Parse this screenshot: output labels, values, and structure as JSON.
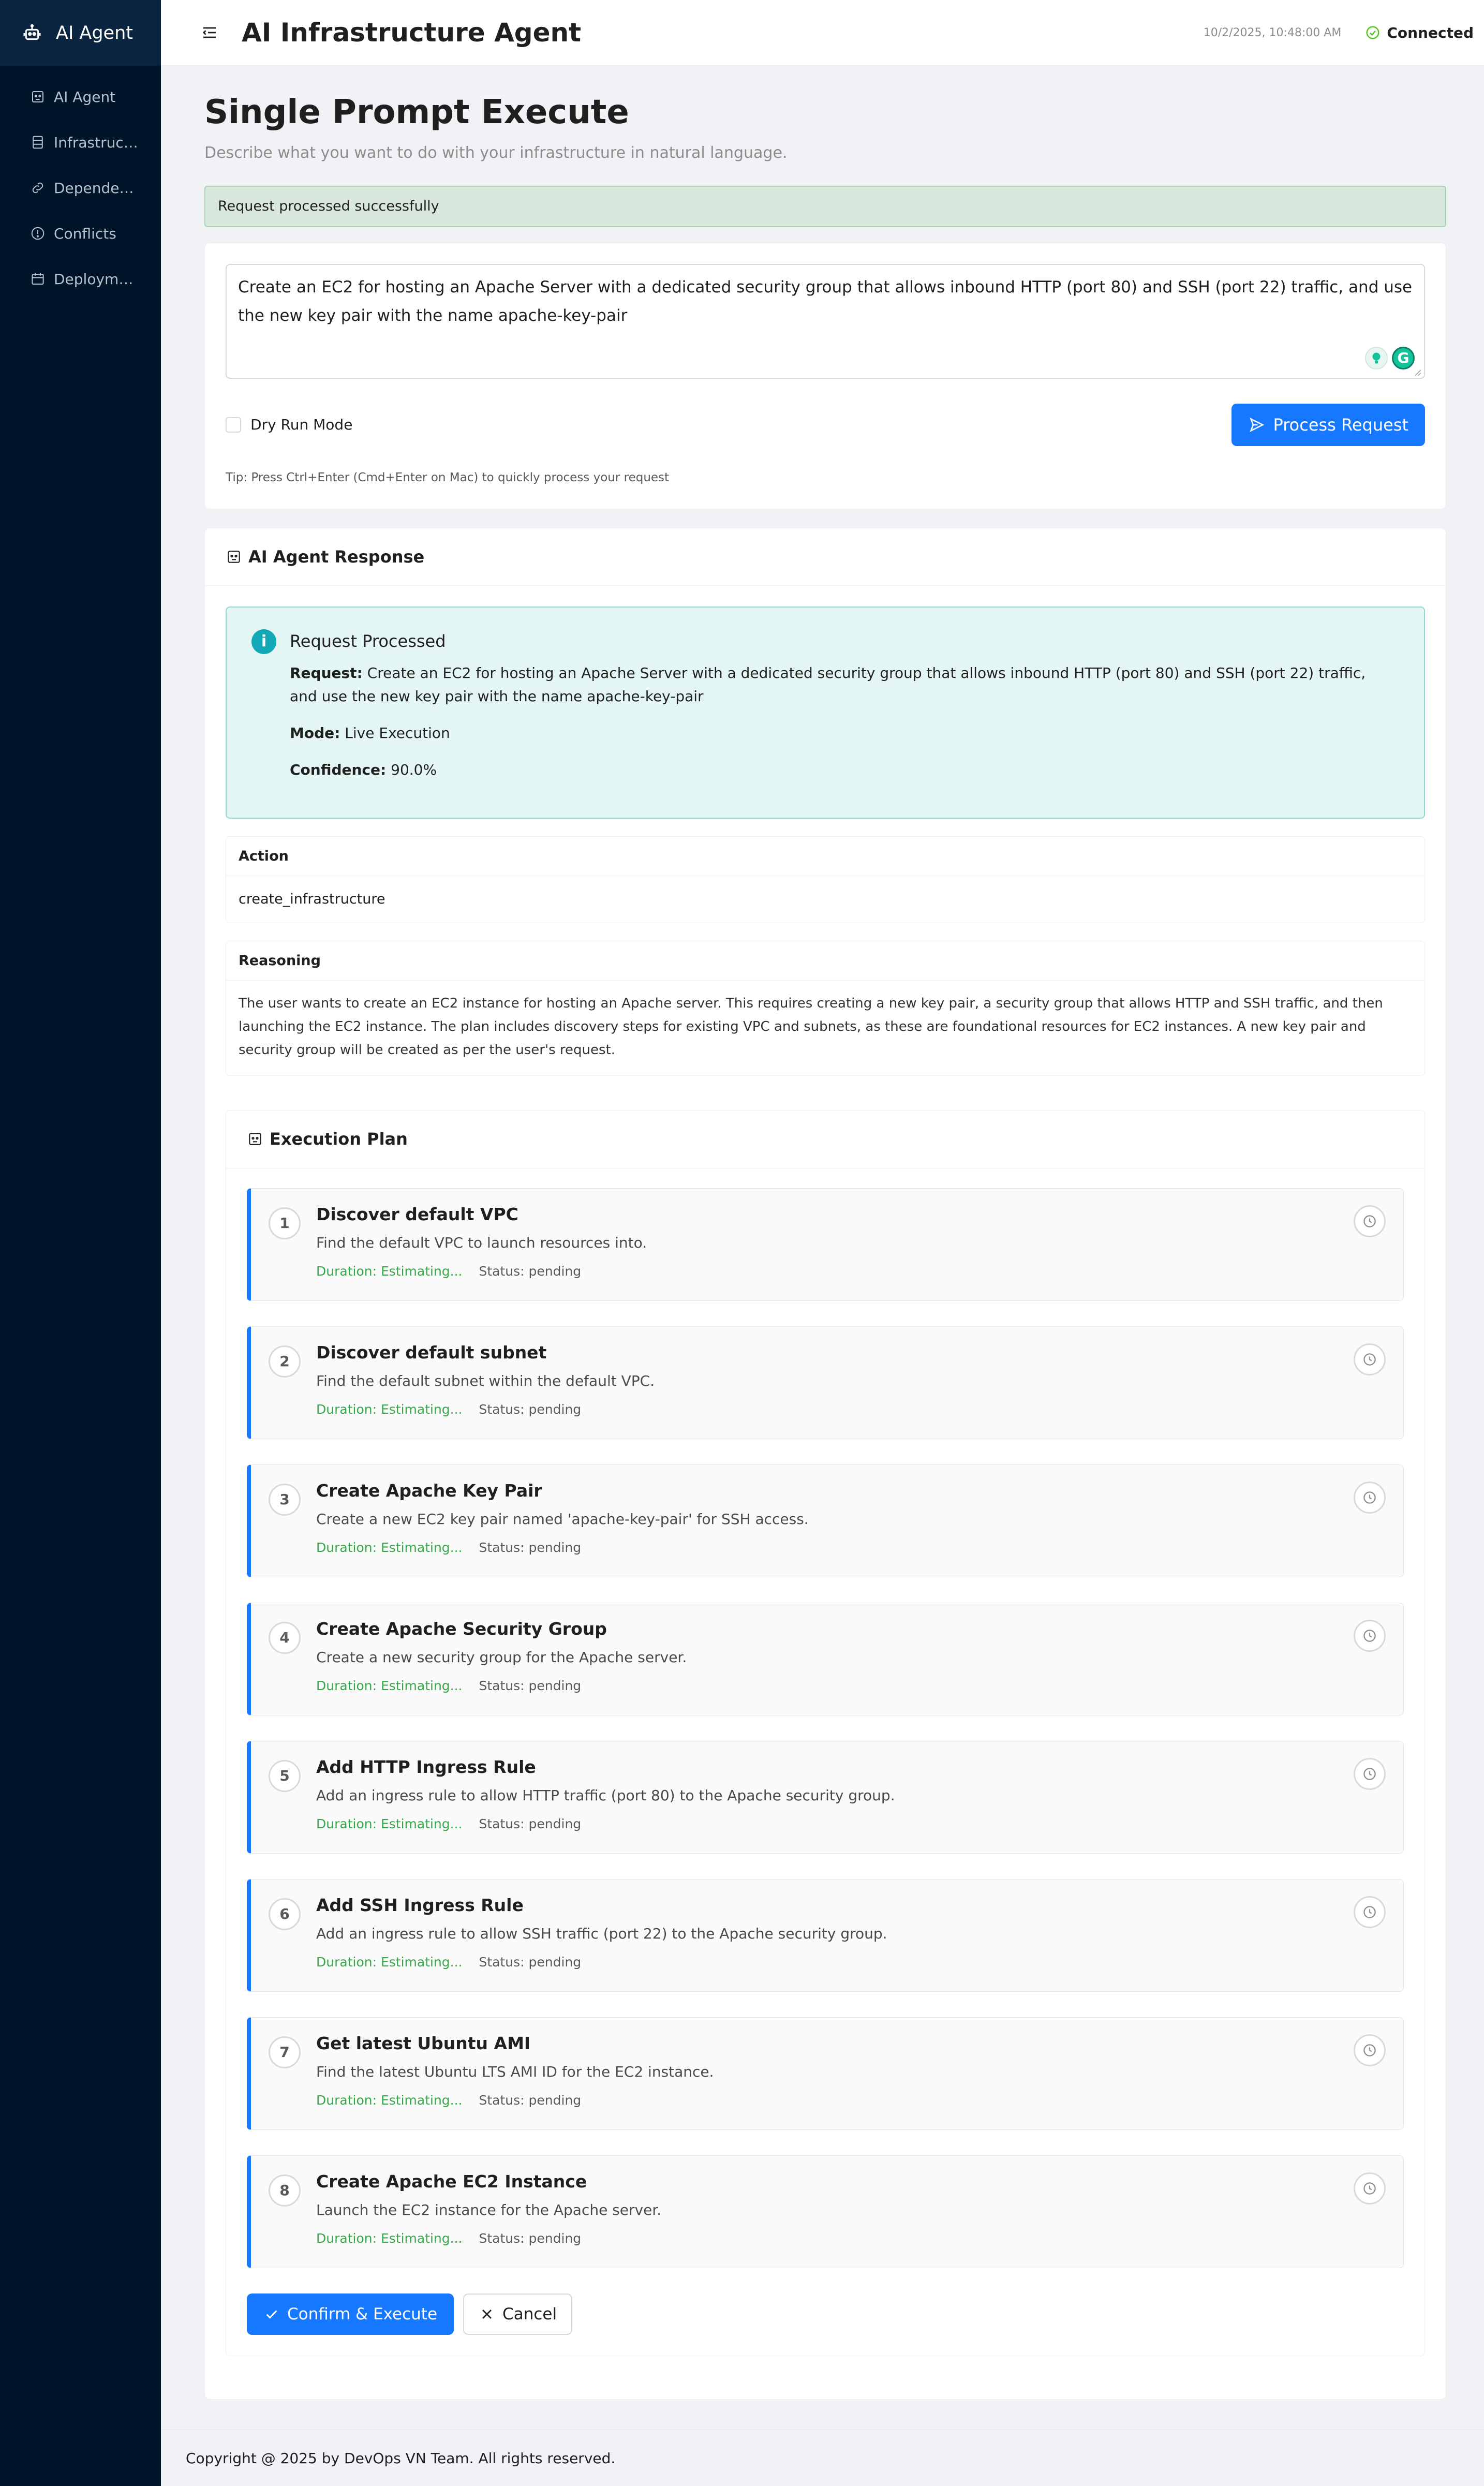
{
  "app": {
    "name": "AI Agent"
  },
  "sidebar": {
    "items": [
      {
        "label": "AI Agent",
        "icon": "robot-icon"
      },
      {
        "label": "Infrastruct...",
        "icon": "database-icon"
      },
      {
        "label": "Dependenc...",
        "icon": "link-icon"
      },
      {
        "label": "Conflicts",
        "icon": "alert-circle-icon"
      },
      {
        "label": "Deploymen...",
        "icon": "calendar-icon"
      }
    ]
  },
  "header": {
    "title": "AI Infrastructure Agent",
    "timestamp": "10/2/2025, 10:48:00 AM",
    "connection": "Connected"
  },
  "page": {
    "title": "Single Prompt Execute",
    "description": "Describe what you want to do with your infrastructure in natural language."
  },
  "alert": {
    "message": "Request processed successfully"
  },
  "prompt": {
    "value": "Create an EC2 for hosting an Apache Server with a dedicated security group that allows inbound HTTP (port 80) and SSH (port 22) traffic, and use the new key pair with the name apache-key-pair",
    "dry_run_label": "Dry Run Mode",
    "dry_run_checked": false,
    "submit_label": "Process Request",
    "tip": "Tip: Press Ctrl+Enter (Cmd+Enter on Mac) to quickly process your request"
  },
  "response": {
    "title": "AI Agent Response",
    "info": {
      "title": "Request Processed",
      "request_label": "Request:",
      "request_value": "Create an EC2 for hosting an Apache Server with a dedicated security group that allows inbound HTTP (port 80) and SSH (port 22) traffic, and use the new key pair with the name apache-key-pair",
      "mode_label": "Mode:",
      "mode_value": "Live Execution",
      "confidence_label": "Confidence:",
      "confidence_value": "90.0%"
    },
    "action": {
      "label": "Action",
      "value": "create_infrastructure"
    },
    "reasoning": {
      "label": "Reasoning",
      "value": "The user wants to create an EC2 instance for hosting an Apache server. This requires creating a new key pair, a security group that allows HTTP and SSH traffic, and then launching the EC2 instance. The plan includes discovery steps for existing VPC and subnets, as these are foundational resources for EC2 instances. A new key pair and security group will be created as per the user's request."
    }
  },
  "plan": {
    "title": "Execution Plan",
    "steps": [
      {
        "num": "1",
        "title": "Discover default VPC",
        "desc": "Find the default VPC to launch resources into.",
        "duration": "Duration: Estimating...",
        "status": "Status: pending"
      },
      {
        "num": "2",
        "title": "Discover default subnet",
        "desc": "Find the default subnet within the default VPC.",
        "duration": "Duration: Estimating...",
        "status": "Status: pending"
      },
      {
        "num": "3",
        "title": "Create Apache Key Pair",
        "desc": "Create a new EC2 key pair named 'apache-key-pair' for SSH access.",
        "duration": "Duration: Estimating...",
        "status": "Status: pending"
      },
      {
        "num": "4",
        "title": "Create Apache Security Group",
        "desc": "Create a new security group for the Apache server.",
        "duration": "Duration: Estimating...",
        "status": "Status: pending"
      },
      {
        "num": "5",
        "title": "Add HTTP Ingress Rule",
        "desc": "Add an ingress rule to allow HTTP traffic (port 80) to the Apache security group.",
        "duration": "Duration: Estimating...",
        "status": "Status: pending"
      },
      {
        "num": "6",
        "title": "Add SSH Ingress Rule",
        "desc": "Add an ingress rule to allow SSH traffic (port 22) to the Apache security group.",
        "duration": "Duration: Estimating...",
        "status": "Status: pending"
      },
      {
        "num": "7",
        "title": "Get latest Ubuntu AMI",
        "desc": "Find the latest Ubuntu LTS AMI ID for the EC2 instance.",
        "duration": "Duration: Estimating...",
        "status": "Status: pending"
      },
      {
        "num": "8",
        "title": "Create Apache EC2 Instance",
        "desc": "Launch the EC2 instance for the Apache server.",
        "duration": "Duration: Estimating...",
        "status": "Status: pending"
      }
    ],
    "confirm_label": "Confirm & Execute",
    "cancel_label": "Cancel"
  },
  "footer": {
    "text": "Copyright @ 2025 by DevOps VN Team. All rights reserved."
  },
  "colors": {
    "sidebar_bg": "#001529",
    "primary": "#1677ff",
    "success_bg": "#d9e8dc",
    "info_bg": "#e4f6f4",
    "duration": "#37a84a"
  }
}
